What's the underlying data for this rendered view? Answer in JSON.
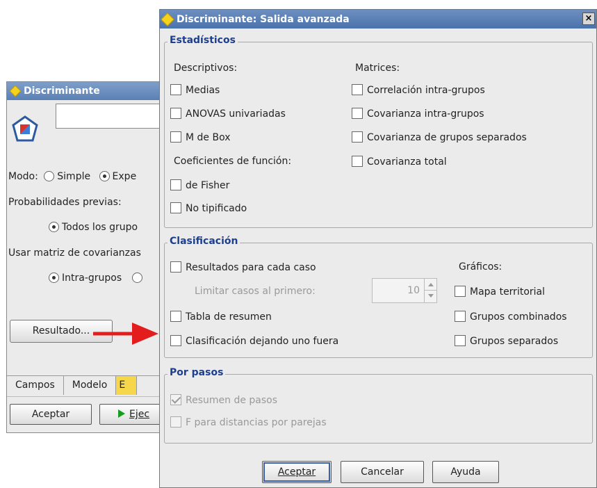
{
  "back_window": {
    "title": "Discriminante",
    "mode_label": "Modo:",
    "mode_simple": "Simple",
    "mode_expert": "Expe",
    "priors_label": "Probabilidades previas:",
    "priors_all": "Todos los grupo",
    "cov_label": "Usar matriz de covarianzas",
    "cov_within": "Intra-grupos",
    "output_button": "Resultado...",
    "tabs": [
      "Campos",
      "Modelo",
      "E"
    ],
    "ok_button": "Aceptar",
    "run_button": "Ejec"
  },
  "dialog": {
    "title": "Discriminante: Salida avanzada",
    "close_glyph": "×",
    "statistics": {
      "legend": "Estadísticos",
      "descriptives_label": "Descriptivos:",
      "means": "Medias",
      "anovas": "ANOVAS univariadas",
      "boxm": "M de Box",
      "coef_label": "Coeficientes de función:",
      "fisher": "de Fisher",
      "unstandardized": "No tipificado",
      "matrices_label": "Matrices:",
      "within_corr": "Correlación intra-grupos",
      "within_cov": "Covarianza intra-grupos",
      "separate_cov": "Covarianza de grupos separados",
      "total_cov": "Covarianza total"
    },
    "classification": {
      "legend": "Clasificación",
      "casewise": "Resultados para cada caso",
      "limit_label": "Limitar casos al primero:",
      "limit_value": "10",
      "summary_table": "Tabla de resumen",
      "leave_one_out": "Clasificación dejando uno fuera",
      "plots_label": "Gráficos:",
      "territorial_map": "Mapa territorial",
      "combined_groups": "Grupos combinados",
      "separate_groups": "Grupos separados"
    },
    "stepwise": {
      "legend": "Por pasos",
      "step_summary": "Resumen de pasos",
      "f_pairwise": "F para distancias por parejas"
    },
    "buttons": {
      "ok": "Aceptar",
      "cancel": "Cancelar",
      "help": "Ayuda"
    }
  }
}
